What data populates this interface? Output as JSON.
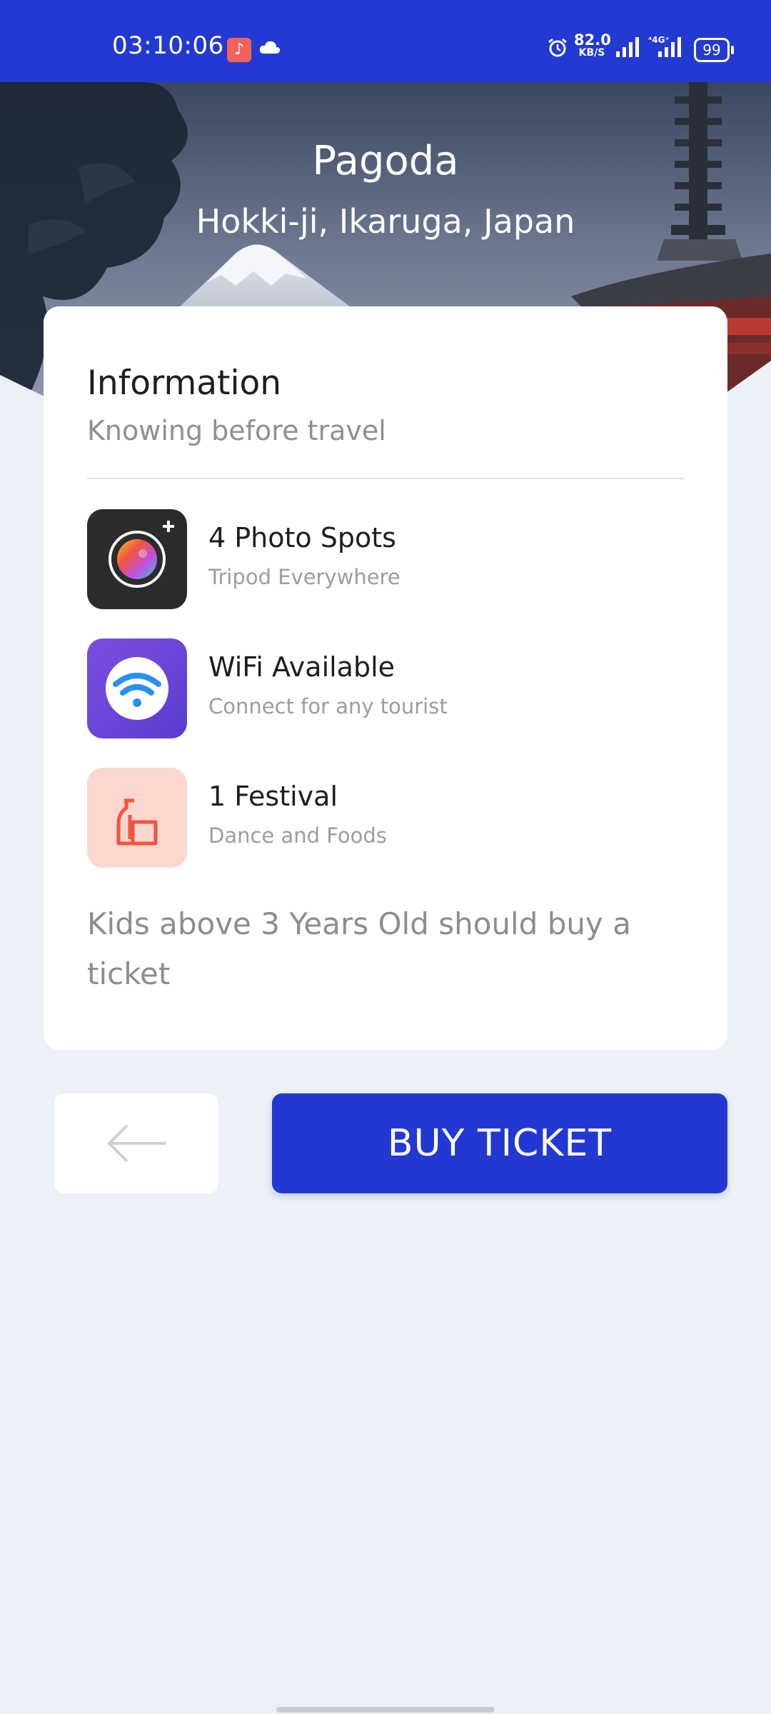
{
  "status_bar": {
    "time": "03:10:06",
    "speed_value": "82.0",
    "speed_unit": "KB/S",
    "battery": "99",
    "icons": [
      "music-app-icon",
      "cloud-icon",
      "alarm-icon",
      "signal-icon",
      "signal-4g-icon",
      "battery-icon"
    ]
  },
  "hero": {
    "title": "Pagoda",
    "subtitle": "Hokki-ji, Ikaruga, Japan"
  },
  "info": {
    "title": "Information",
    "subtitle": "Knowing before travel",
    "features": [
      {
        "title": "4 Photo Spots",
        "subtitle": "Tripod Everywhere",
        "icon": "camera-icon"
      },
      {
        "title": "WiFi Available",
        "subtitle": "Connect for any tourist",
        "icon": "wifi-icon"
      },
      {
        "title": "1 Festival",
        "subtitle": "Dance and Foods",
        "icon": "bottle-cup-icon"
      }
    ],
    "note": "Kids above 3 Years Old should buy a ticket"
  },
  "actions": {
    "back_icon": "arrow-left-icon",
    "buy_label": "BUY TICKET"
  },
  "colors": {
    "primary": "#2238d3",
    "background": "#ecf0f7",
    "festival_bg": "#fdd7cf",
    "festival_icon": "#f0553f"
  }
}
